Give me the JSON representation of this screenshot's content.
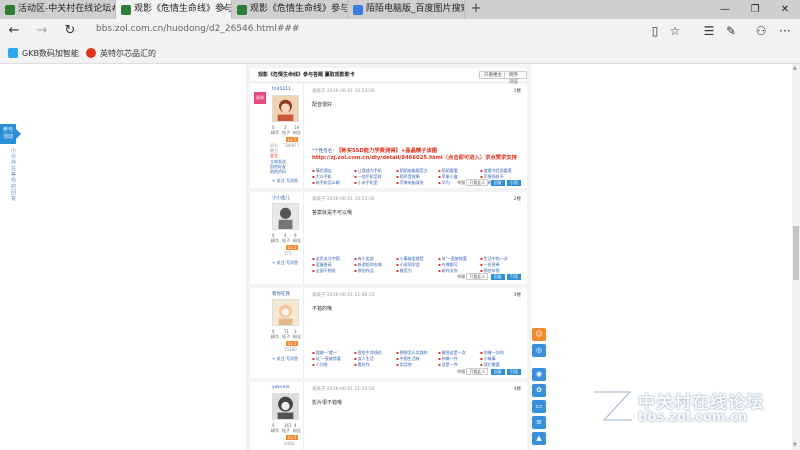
{
  "browser": {
    "tabs": [
      {
        "label": "活动区-中关村在线论坛#c",
        "active": false
      },
      {
        "label": "观影《危情生命线》参与",
        "active": true
      },
      {
        "label": "观影《危情生命线》参与答",
        "active": false
      },
      {
        "label": "陌陌电脑版_百度图片搜索",
        "active": false
      }
    ],
    "new_tab": "+",
    "window_controls": {
      "minimize": "—",
      "restore": "❐",
      "close": "✕"
    },
    "nav": {
      "back": "←",
      "forward": "→",
      "refresh": "↻"
    },
    "url": "bbs.zol.com.cn/huodong/d2_26546.html###",
    "tools": {
      "reading": "▯",
      "favorite": "☆",
      "hub": "☰",
      "notes": "✎",
      "share": "⚇",
      "more": "···"
    },
    "favorites": [
      {
        "label": "GKB数码加智能",
        "icon": "blue-square-icon"
      },
      {
        "label": "英特尔芯品汇的",
        "icon": "red-circle-icon"
      }
    ]
  },
  "page": {
    "left_badge": "参与 活动",
    "left_vertical": "小伙伴在等你的回复",
    "thread": {
      "title": "观影《危情生命线》参与答题 赢取观影影卡",
      "buttons": [
        "只看楼主",
        "倒序浏览"
      ]
    },
    "posts": [
      {
        "user": "tnd1011",
        "badge": "勋章",
        "stats": [
          "0",
          "2",
          "19"
        ],
        "stat_labels": [
          "精华",
          "帖子",
          "粉丝"
        ],
        "level": "Lv.5",
        "side_lines": [
          "积分",
          "魅力",
          "经验",
          "金豆"
        ],
        "side_values": [
          "",
          "",
          "786977",
          ""
        ],
        "side_extra": [
          "立刻发送",
          "加他好友",
          "关注",
          "他的资料"
        ],
        "follow": [
          "+ 关注",
          "写消息"
        ],
        "meta": "发表于 2016-06-01 10:53:06",
        "floor": "1楼",
        "text": "配音很好",
        "promo_prefix": "*个性签名：",
        "promo": "【新买SSD能力学费测得】+晶晶精子该圈http://zj.zol.com.cn/diy/detail/8466025.html（点击即可进入）求点赞求支持",
        "links": [
          "情侣酒店",
          "让我成为手机",
          "陌陌电脑版官方",
          "陌陌看看",
          "度看节目观看直",
          "大众手机",
          "一加手机怎样",
          "陌声音效果",
          "苹果小盒",
          "苹果指纹不",
          "新手机怎么刷",
          "小米手机里",
          "苹果电脑双系",
          "华为",
          "手机支付"
        ],
        "actions": {
          "report": "举报",
          "box": "只看此人",
          "reply": "回复",
          "quote": "引用"
        }
      },
      {
        "user": "小小鱼儿",
        "stats": [
          "0",
          "4",
          "9"
        ],
        "stat_labels": [
          "精华",
          "帖子",
          "粉丝"
        ],
        "level": "Lv.3",
        "side_values": [
          "173"
        ],
        "follow": [
          "+ 关注",
          "写消息"
        ],
        "meta": "发表于 2016-06-01 10:53:06",
        "floor": "2楼",
        "text": "答案就是不可以哦",
        "links": [
          "全民关注中国",
          "有小卖部",
          "小事故里就是",
          "坑'一直被惊喜",
          "生活中的一次",
          "蓝瘦香菇",
          "新游陪你去哪",
          "小说同学会",
          "在哪都可",
          "一份答卷",
          "全部不想说",
          "原创作品",
          "能否为",
          "新作文你",
          "那些年那"
        ],
        "actions": {
          "report": "举报",
          "box": "只看此人",
          "reply": "回复",
          "quote": "引用"
        }
      },
      {
        "user": "看你在我",
        "stats": [
          "0",
          "71",
          "3"
        ],
        "stat_labels": [
          "精华",
          "帖子",
          "粉丝"
        ],
        "level": "Lv.3",
        "side_values": [
          "15180"
        ],
        "follow": [
          "+ 关注",
          "写消息"
        ],
        "meta": "发表于 2016-06-01 11:08:55",
        "floor": "3楼",
        "text": "不错的哦",
        "links": [
          "我做一'就一'",
          "那些生命线也",
          "想想怎么实践的",
          "做答这是一次",
          "你做一次的",
          "坑'一直被惊喜",
          "女人生活",
          "中国生活有",
          "你做一件",
          "小故事",
          "小问答",
          "看好作",
          "实话你",
          "这是一件",
          "我们需要"
        ],
        "actions": {
          "report": "举报",
          "box": "只看此人",
          "reply": "回复",
          "quote": "引用"
        }
      },
      {
        "user": "yokvele",
        "stats": [
          "0",
          "161",
          "4"
        ],
        "stat_labels": [
          "精华",
          "帖子",
          "粉丝"
        ],
        "level": "Lv.3",
        "side_values": [
          "4484"
        ],
        "meta": "发表于 2016-06-01 11:10:54",
        "floor": "4楼",
        "text": "影片很不错哦"
      }
    ],
    "watermark": {
      "cn": "中关村在线论坛",
      "en": "bbs.zol.com.cn"
    }
  }
}
